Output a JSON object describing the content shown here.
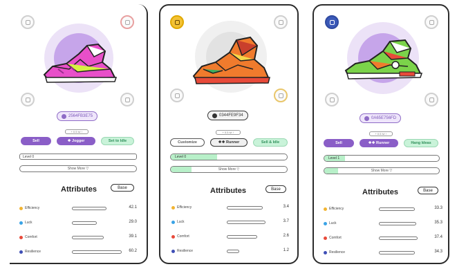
{
  "cards": [
    {
      "badge": "2564FB3E75",
      "hint": "+ 0.5 lvl ↑",
      "btn_left": "Sell",
      "btn_mid": "❖ Jogger",
      "btn_right": "Set to Idle",
      "level": "Level 0",
      "show_more": "Show More ▽",
      "attributes_title": "Attributes",
      "base_label": "Base",
      "attrs": [
        {
          "name": "Efficiency",
          "value": "42.1",
          "color": "#f2b431",
          "fill": 0.58
        },
        {
          "name": "Luck",
          "value": "29.0",
          "color": "#3aa3e6",
          "fill": 0.4
        },
        {
          "name": "Comfort",
          "value": "39.1",
          "color": "#e84a3a",
          "fill": 0.54
        },
        {
          "name": "Resilience",
          "value": "60.2",
          "color": "#3f4fb6",
          "fill": 0.9
        }
      ]
    },
    {
      "badge": "0344FE9F34",
      "hint": "+ 0.5 lvl ↑",
      "btn_left": "Customize",
      "btn_mid": "❖❖ Runner",
      "btn_right": "Sell & Idle",
      "level": "Level 0",
      "show_more": "Show More ▽",
      "attributes_title": "Attributes",
      "base_label": "Base",
      "attrs": [
        {
          "name": "Efficiency",
          "value": "3.4",
          "color": "#f2b431",
          "fill": 0.85
        },
        {
          "name": "Luck",
          "value": "3.7",
          "color": "#3aa3e6",
          "fill": 0.9
        },
        {
          "name": "Comfort",
          "value": "2.6",
          "color": "#e84a3a",
          "fill": 0.7
        },
        {
          "name": "Resilience",
          "value": "1.2",
          "color": "#3f4fb6",
          "fill": 0.35
        }
      ]
    },
    {
      "badge": "0A65E756FD",
      "hint": "+ 0.5 lvl ↑",
      "btn_left": "Sell",
      "btn_mid": "❖❖ Runner",
      "btn_right": "Hang Ideas",
      "level": "Level 1",
      "show_more": "Show More ▽",
      "attributes_title": "Attributes",
      "base_label": "Base",
      "attrs": [
        {
          "name": "Efficiency",
          "value": "33.3",
          "color": "#f2b431",
          "fill": 0.6
        },
        {
          "name": "Luck",
          "value": "35.3",
          "color": "#3aa3e6",
          "fill": 0.62
        },
        {
          "name": "Comfort",
          "value": "37.4",
          "color": "#e84a3a",
          "fill": 0.65
        },
        {
          "name": "Resilience",
          "value": "34.3",
          "color": "#3f4fb6",
          "fill": 0.6
        }
      ]
    }
  ]
}
